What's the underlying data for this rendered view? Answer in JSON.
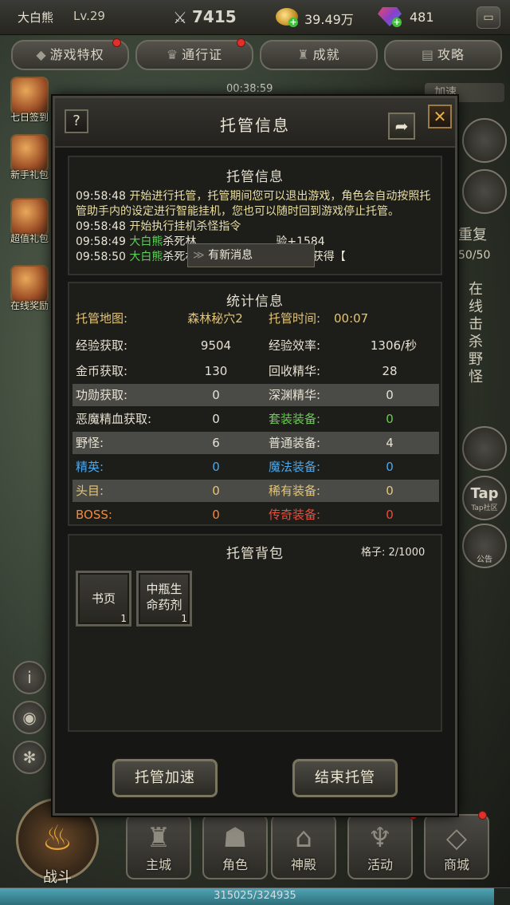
{
  "player": {
    "name": "大白熊",
    "level": "Lv.29",
    "power": "7415",
    "gold": "39.49万",
    "gems": "481"
  },
  "top_tabs": [
    {
      "label": "游戏特权",
      "icon": "gem-icon"
    },
    {
      "label": "通行证",
      "icon": "crown-icon"
    },
    {
      "label": "成就",
      "icon": "trophy-icon"
    },
    {
      "label": "攻略",
      "icon": "book-icon"
    }
  ],
  "timer": "00:38:59",
  "speed_label": "加速",
  "left_side": [
    {
      "label": "七日签到"
    },
    {
      "label": "新手礼包"
    },
    {
      "label": "超值礼包"
    },
    {
      "label": "在线奖励"
    }
  ],
  "right_side": {
    "repeat_label": "重复",
    "kill_count": "50/50",
    "vertical_text": "在线击杀野怪",
    "tap_label": "Tap",
    "tap_sub": "Tap社区",
    "notice_label": "公告"
  },
  "bottom_nav": [
    {
      "label": "主城"
    },
    {
      "label": "角色"
    },
    {
      "label": "神殿"
    },
    {
      "label": "活动"
    },
    {
      "label": "商城"
    }
  ],
  "fight_label": "战斗",
  "exp": {
    "current": 315025,
    "max": 324935,
    "text": "315025/324935"
  },
  "modal": {
    "title": "托管信息",
    "help": "?",
    "close": "✕",
    "log_panel": {
      "title": "托管信息",
      "entries": [
        {
          "time": "09:58:48",
          "text": "开始进行托管，托管期间您可以退出游戏，角色会自动按照托管助手内的设定进行智能挂机，您也可以随时回到游戏停止托管。"
        },
        {
          "time": "09:58:48",
          "text": "开始执行挂机杀怪指令"
        },
        {
          "time": "09:58:49",
          "name": "大白熊",
          "text": "杀死林",
          "tail": "验+1584"
        },
        {
          "time": "09:58:50",
          "name": "大白熊",
          "text": "杀死林中野兽，经验+1584，获得【"
        }
      ],
      "new_message": "有新消息"
    },
    "stats_panel": {
      "title": "统计信息",
      "rows": [
        {
          "l1": "托管地图:",
          "v1": "森林秘穴2",
          "l2": "托管时间:",
          "v2": "00:07"
        },
        {
          "l1": "经验获取:",
          "v1": "9504",
          "l2": "经验效率:",
          "v2": "1306/秒"
        },
        {
          "l1": "金币获取:",
          "v1": "130",
          "l2": "回收精华:",
          "v2": "28"
        },
        {
          "l1": "功勋获取:",
          "v1": "0",
          "l2": "深渊精华:",
          "v2": "0"
        },
        {
          "l1": "恶魔精血获取:",
          "v1": "0",
          "l2": "套装装备:",
          "v2": "0"
        },
        {
          "l1": "野怪:",
          "v1": "6",
          "l2": "普通装备:",
          "v2": "4"
        },
        {
          "l1": "精英:",
          "v1": "0",
          "l2": "魔法装备:",
          "v2": "0"
        },
        {
          "l1": "头目:",
          "v1": "0",
          "l2": "稀有装备:",
          "v2": "0"
        },
        {
          "l1": "BOSS:",
          "v1": "0",
          "l2": "传奇装备:",
          "v2": "0"
        }
      ]
    },
    "bag_panel": {
      "title": "托管背包",
      "capacity": "格子: 2/1000",
      "items": [
        {
          "name": "书页",
          "count": "1"
        },
        {
          "name": "中瓶生命药剂",
          "count": "1"
        }
      ]
    },
    "buttons": {
      "speed_up": "托管加速",
      "end": "结束托管"
    }
  }
}
